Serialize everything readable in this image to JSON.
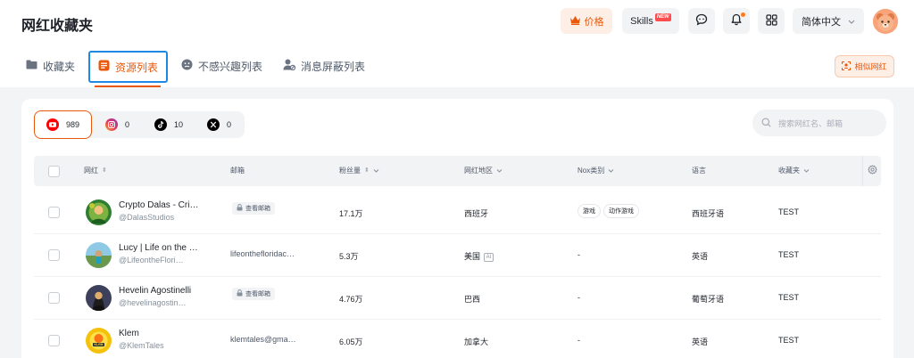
{
  "header": {
    "app_title": "网红收藏夹",
    "price_label": "价格",
    "skills_label": "Skills",
    "skills_badge": "NEW",
    "language_label": "简体中文"
  },
  "tabs": [
    {
      "label": "收藏夹",
      "icon": "folder-icon",
      "active": false
    },
    {
      "label": "资源列表",
      "icon": "list-icon",
      "active": true
    },
    {
      "label": "不感兴趣列表",
      "icon": "unhappy-face-icon",
      "active": false
    },
    {
      "label": "消息屏蔽列表",
      "icon": "user-block-icon",
      "active": false
    }
  ],
  "similar_button_label": "相似网红",
  "platforms": [
    {
      "name": "youtube",
      "count": "989",
      "active": true
    },
    {
      "name": "instagram",
      "count": "0",
      "active": false
    },
    {
      "name": "tiktok",
      "count": "10",
      "active": false
    },
    {
      "name": "x",
      "count": "0",
      "active": false
    }
  ],
  "search": {
    "placeholder": "搜索网红名、邮箱"
  },
  "table": {
    "columns": [
      "网红",
      "邮箱",
      "粉丝量",
      "网红地区",
      "Nox类别",
      "语言",
      "收藏夹"
    ],
    "view_email_label": "查看邮箱",
    "rows": [
      {
        "name": "Crypto Dalas - Cri…",
        "handle": "@DalasStudios",
        "email": "查看邮箱",
        "email_locked": true,
        "followers": "17.1万",
        "region": "西班牙",
        "categories": [
          "游戏",
          "动作游戏"
        ],
        "language": "西班牙语",
        "folder": "TEST"
      },
      {
        "name": "Lucy | Life on the …",
        "handle": "@LifeontheFlori…",
        "email": "lifeonthefloridac…",
        "email_locked": false,
        "followers": "5.3万",
        "region": "美国",
        "region_ai": true,
        "categories": [],
        "category_placeholder": "-",
        "language": "英语",
        "folder": "TEST"
      },
      {
        "name": "Hevelin Agostinelli",
        "handle": "@hevelinagostin…",
        "email": "查看邮箱",
        "email_locked": true,
        "followers": "4.76万",
        "region": "巴西",
        "categories": [],
        "category_placeholder": "-",
        "language": "葡萄牙语",
        "folder": "TEST"
      },
      {
        "name": "Klem",
        "handle": "@KlemTales",
        "email": "klemtales@gma…",
        "email_locked": false,
        "followers": "6.05万",
        "region": "加拿大",
        "categories": [],
        "category_placeholder": "-",
        "language": "英语",
        "folder": "TEST"
      }
    ]
  },
  "ai_badge_label": "AI",
  "colors": {
    "accent": "#e8590c",
    "focus": "#1e88e5",
    "youtube": "#ff0000"
  }
}
